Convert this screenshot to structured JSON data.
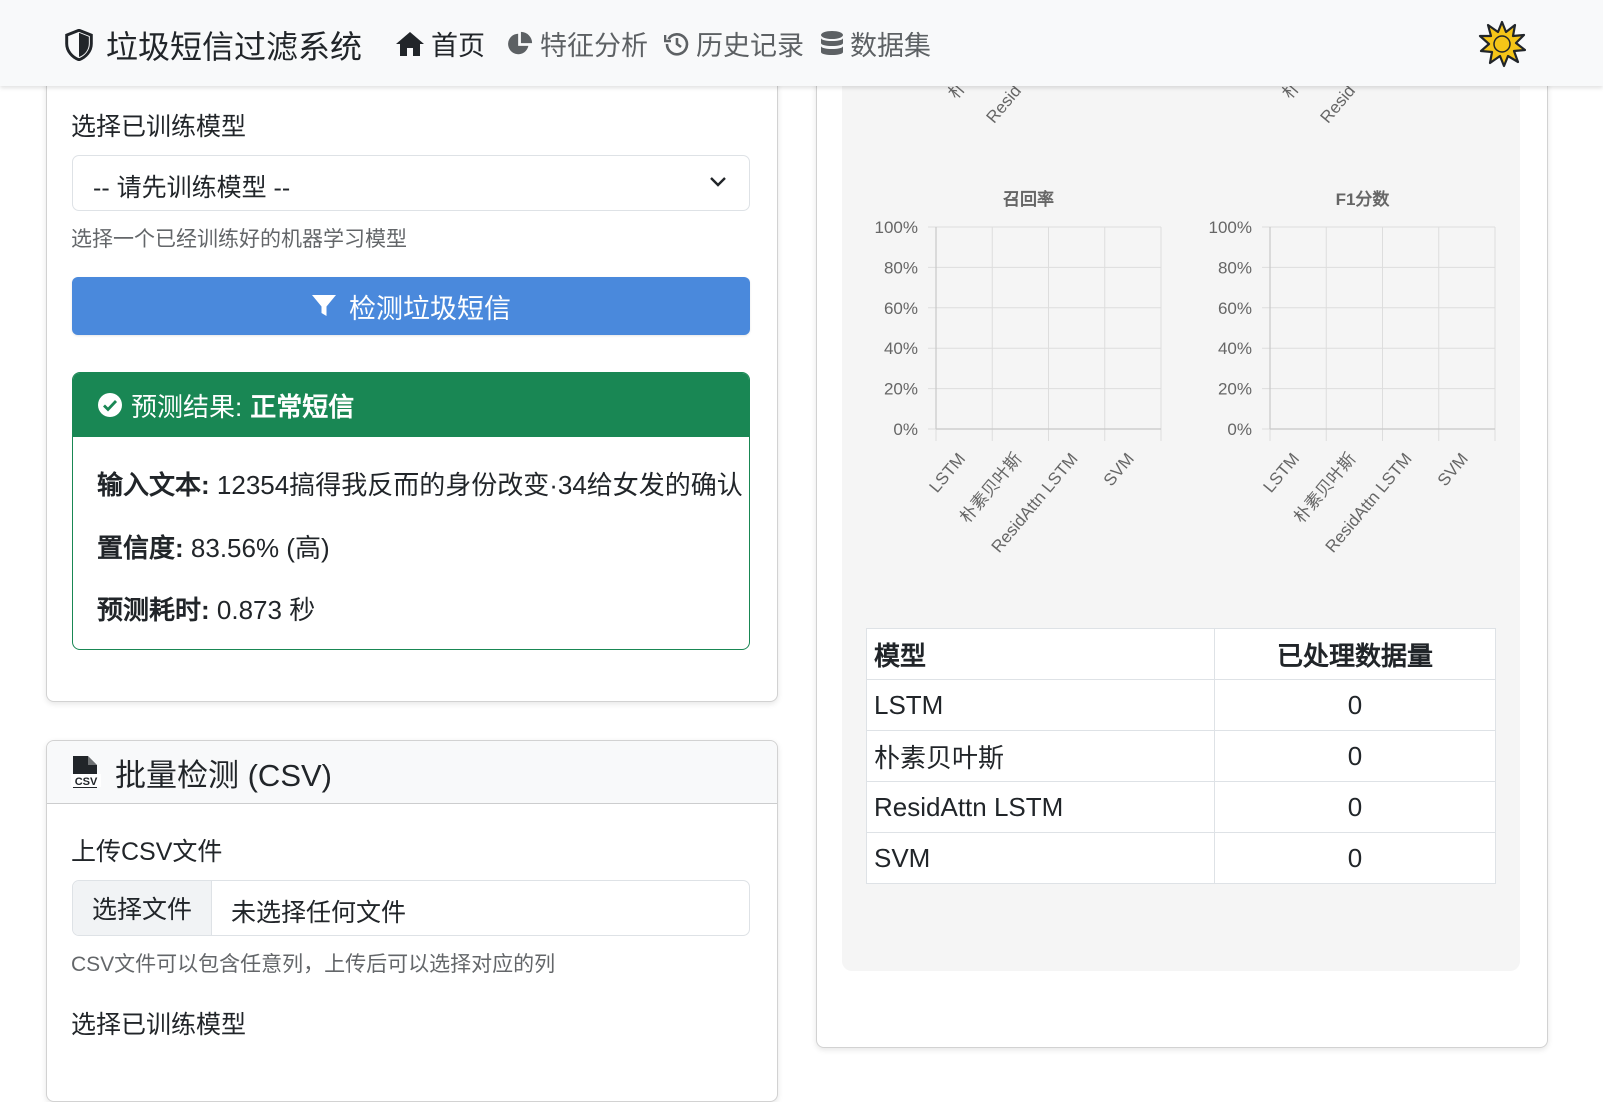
{
  "navbar": {
    "brand": "垃圾短信过滤系统",
    "items": [
      {
        "label": "首页",
        "icon": "home-icon"
      },
      {
        "label": "特征分析",
        "icon": "pie-chart-icon"
      },
      {
        "label": "历史记录",
        "icon": "history-icon"
      },
      {
        "label": "数据集",
        "icon": "database-icon"
      }
    ],
    "theme_icon": "sun-icon"
  },
  "single": {
    "model_label": "选择已训练模型",
    "model_select_value": "-- 请先训练模型 --",
    "model_hint": "选择一个已经训练好的机器学习模型",
    "detect_button": "检测垃圾短信",
    "result": {
      "header_prefix": "预测结果:",
      "header_value": "正常短信",
      "input_label": "输入文本:",
      "input_value": "12354搞得我反而的身份改变·34给女发的确认",
      "confidence_label": "置信度:",
      "confidence_value": "83.56% (高)",
      "time_label": "预测耗时:",
      "time_value": "0.873 秒"
    }
  },
  "batch": {
    "title": "批量检测 (CSV)",
    "upload_label": "上传CSV文件",
    "file_button": "选择文件",
    "file_status": "未选择任何文件",
    "upload_hint": "CSV文件可以包含任意列，上传后可以选择对应的列",
    "model_label": "选择已训练模型"
  },
  "chart_data": [
    {
      "type": "bar",
      "title": "召回率",
      "categories": [
        "LSTM",
        "朴素贝叶斯",
        "ResidAttn LSTM",
        "SVM"
      ],
      "values": [
        0,
        0,
        0,
        0
      ],
      "ylim": [
        0,
        100
      ],
      "yticks": [
        "100%",
        "80%",
        "60%",
        "40%",
        "20%",
        "0%"
      ],
      "grid": true
    },
    {
      "type": "bar",
      "title": "F1分数",
      "categories": [
        "LSTM",
        "朴素贝叶斯",
        "ResidAttn LSTM",
        "SVM"
      ],
      "values": [
        0,
        0,
        0,
        0
      ],
      "ylim": [
        0,
        100
      ],
      "yticks": [
        "100%",
        "80%",
        "60%",
        "40%",
        "20%",
        "0%"
      ],
      "grid": true
    }
  ],
  "clipped_labels": [
    "朴",
    "Resid",
    "朴",
    "Resid"
  ],
  "stats_table": {
    "headers": [
      "模型",
      "已处理数据量"
    ],
    "rows": [
      [
        "LSTM",
        "0"
      ],
      [
        "朴素贝叶斯",
        "0"
      ],
      [
        "ResidAttn LSTM",
        "0"
      ],
      [
        "SVM",
        "0"
      ]
    ]
  },
  "colors": {
    "primary": "#4a89dc",
    "success": "#198754",
    "navbar_bg": "#f8f9fa",
    "chart_bg": "#f5f5f5"
  }
}
